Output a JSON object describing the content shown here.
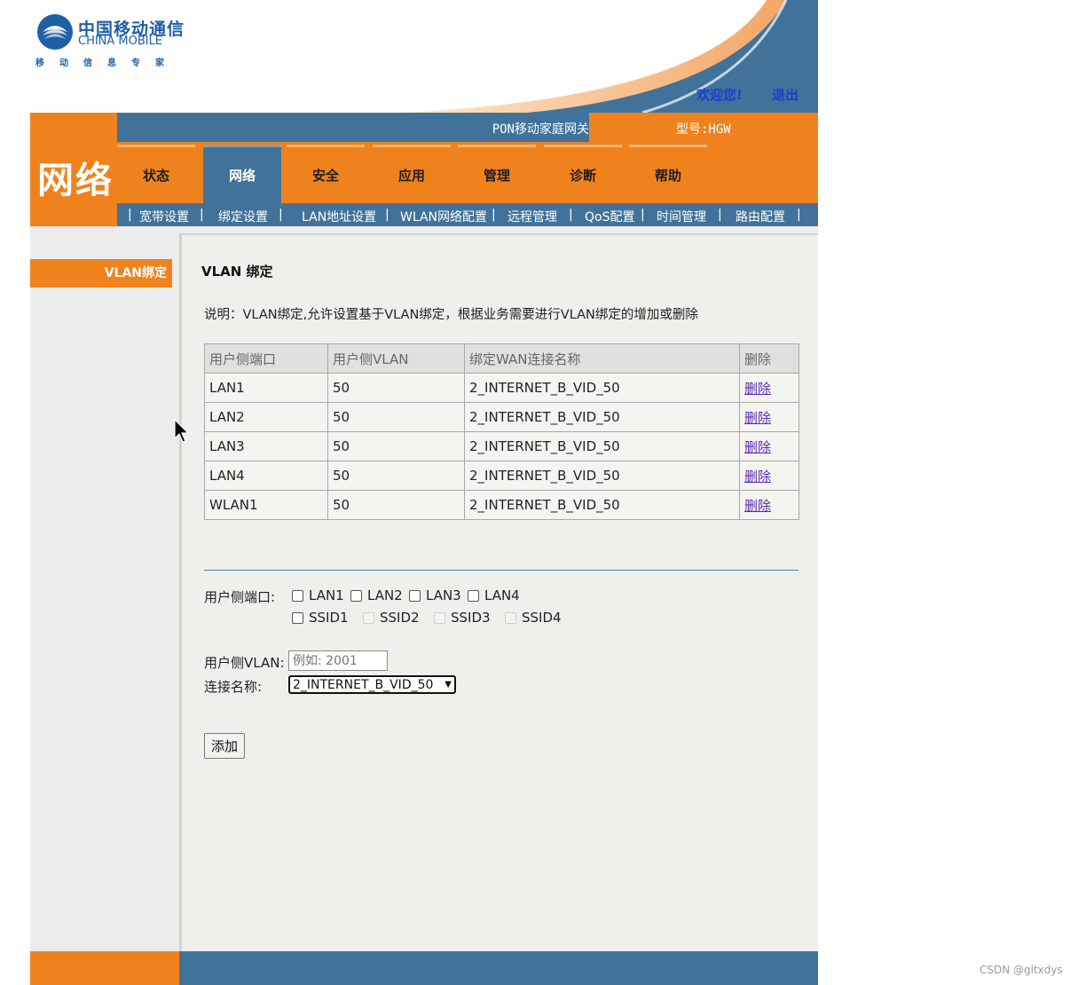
{
  "header": {
    "logo_cn": "中国移动通信",
    "logo_en": "CHINA MOBILE",
    "logo_slogan": "移动信息专家",
    "welcome": "欢迎您!",
    "logout": "退出"
  },
  "nav": {
    "brand": "网络",
    "product": "PON移动家庭网关",
    "model": "型号:HGW",
    "tabs": [
      "状态",
      "网络",
      "安全",
      "应用",
      "管理",
      "诊断",
      "帮助"
    ],
    "active_tab": "网络"
  },
  "subnav": [
    "宽带设置",
    "绑定设置",
    "LAN地址设置",
    "WLAN网络配置",
    "远程管理",
    "QoS配置",
    "时间管理",
    "路由配置"
  ],
  "sidebar": {
    "item": "VLAN绑定"
  },
  "content": {
    "title": "VLAN 绑定",
    "description": "说明：VLAN绑定,允许设置基于VLAN绑定，根据业务需要进行VLAN绑定的增加或删除",
    "table": {
      "headers": [
        "用户侧端口",
        "用户侧VLAN",
        "绑定WAN连接名称",
        "删除"
      ],
      "rows": [
        [
          "LAN1",
          "50",
          "2_INTERNET_B_VID_50",
          "删除"
        ],
        [
          "LAN2",
          "50",
          "2_INTERNET_B_VID_50",
          "删除"
        ],
        [
          "LAN3",
          "50",
          "2_INTERNET_B_VID_50",
          "删除"
        ],
        [
          "LAN4",
          "50",
          "2_INTERNET_B_VID_50",
          "删除"
        ],
        [
          "WLAN1",
          "50",
          "2_INTERNET_B_VID_50",
          "删除"
        ]
      ]
    },
    "form": {
      "port_label": "用户侧端口:",
      "ports_row1": [
        "LAN1",
        "LAN2",
        "LAN3",
        "LAN4"
      ],
      "ports_row2": [
        "SSID1",
        "SSID2",
        "SSID3",
        "SSID4"
      ],
      "vlan_label": "用户侧VLAN:",
      "vlan_placeholder": "例如: 2001",
      "conn_label": "连接名称:",
      "conn_selected": "2_INTERNET_B_VID_50",
      "add_button": "添加"
    }
  },
  "watermark": "CSDN @gltxdys",
  "colors": {
    "orange": "#f0821e",
    "blue": "#41739a",
    "link": "#1a3fd1"
  }
}
